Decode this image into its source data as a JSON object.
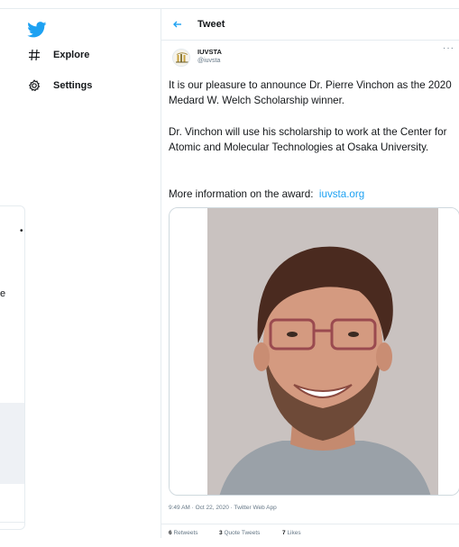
{
  "nav": {
    "logo_icon": "twitter-bird-icon",
    "items": [
      {
        "label": "Explore",
        "icon": "hashtag-icon"
      },
      {
        "label": "Settings",
        "icon": "gear-icon"
      }
    ]
  },
  "background_panel": {
    "dot": "•",
    "letter": "e"
  },
  "header": {
    "back_icon": "arrow-left-icon",
    "title": "Tweet"
  },
  "tweet": {
    "author_name": "IUVSTA",
    "author_handle": "@iuvsta",
    "more_icon": "more-dots-icon",
    "paragraph_1": "It is our pleasure to announce Dr. Pierre Vinchon as the 2020 Medard W. Welch Scholarship winner.",
    "paragraph_2": "Dr. Vinchon will use his scholarship to work at the Center for Atomic and Molecular Technologies at Osaka University.",
    "paragraph_3_prefix": "More information on the award:",
    "link_text": "iuvsta.org",
    "timestamp": "9:49 AM · Oct 22, 2020",
    "source_separator": " · ",
    "source": "Twitter Web App",
    "retweets_count": "6",
    "retweets_label": "Retweets",
    "quote_count": "3",
    "quote_label": "Quote Tweets",
    "likes_count": "7",
    "likes_label": "Likes"
  },
  "colors": {
    "accent": "#1da1f2",
    "text": "#14171a",
    "secondary": "#657786",
    "border": "#e6ecf0"
  }
}
